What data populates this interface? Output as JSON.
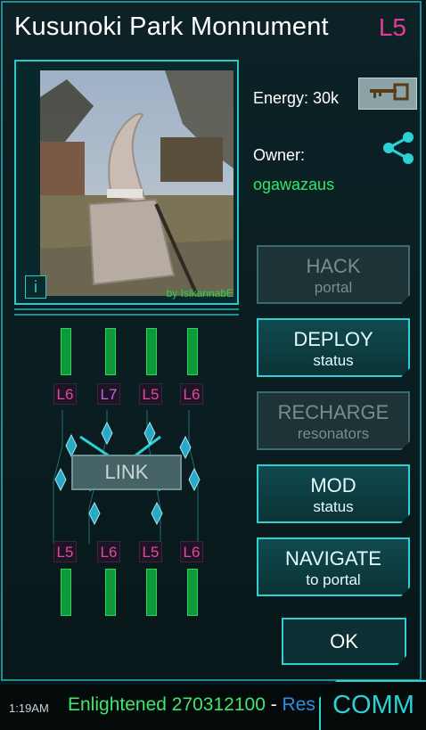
{
  "portal": {
    "title": "Kusunoki Park Monnument",
    "level": "L5",
    "photo_credit": "by IsikannabЕ",
    "info_label": "i",
    "energy_label": "Energy: 30k",
    "owner_label": "Owner:",
    "owner_name": "ogawazaus"
  },
  "actions": [
    {
      "title": "HACK",
      "subtitle": "portal",
      "state": "disabled"
    },
    {
      "title": "DEPLOY",
      "subtitle": "status",
      "state": "active"
    },
    {
      "title": "RECHARGE",
      "subtitle": "resonators",
      "state": "disabled"
    },
    {
      "title": "MOD",
      "subtitle": "status",
      "state": "active"
    },
    {
      "title": "NAVIGATE",
      "subtitle": "to portal",
      "state": "active"
    }
  ],
  "ok_label": "OK",
  "link_label": "LINK",
  "resonators": {
    "top": [
      "L6",
      "L7",
      "L5",
      "L6"
    ],
    "bottom": [
      "L5",
      "L6",
      "L5",
      "L6"
    ]
  },
  "statusbar": {
    "time": "1:19AM",
    "team": "Enlightened 270312100",
    "dash": " - ",
    "rest": "Res",
    "comm_label": "COMM"
  },
  "colors": {
    "accent": "#2bd1d4",
    "enlightened": "#3ee86a",
    "resistance": "#2d8fe0",
    "level": "#e7399a"
  },
  "icons": [
    "key-icon",
    "share-icon",
    "info-icon"
  ]
}
